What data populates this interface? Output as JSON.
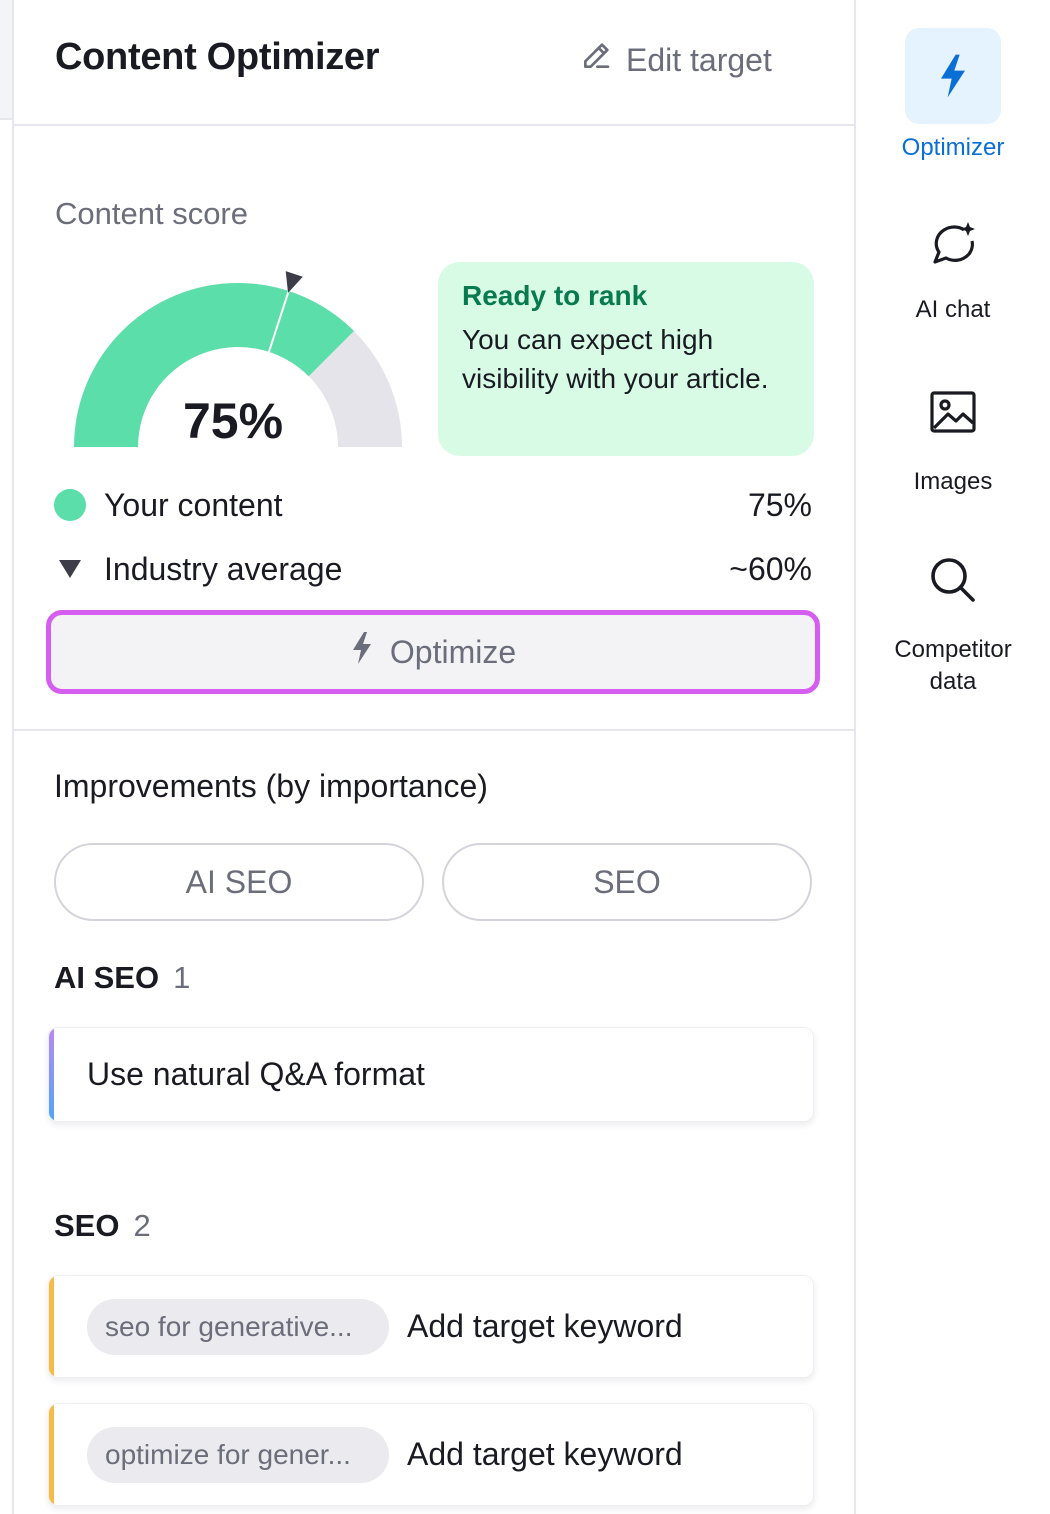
{
  "header": {
    "title": "Content Optimizer",
    "edit_target": "Edit target",
    "edit_icon": "pencil-icon"
  },
  "score": {
    "label": "Content score",
    "value_text": "75%",
    "value": 75,
    "industry_average": 60,
    "colors": {
      "your_content": "#5cdeaa",
      "remaining": "#e4e4ea",
      "marker": "#3c3d48"
    },
    "status_title": "Ready to rank",
    "status_text": "You can expect high visibility with your article.",
    "legend": [
      {
        "label": "Your content",
        "value": "75%"
      },
      {
        "label": "Industry average",
        "value": "~60%"
      }
    ]
  },
  "optimize_button": {
    "label": "Optimize",
    "icon": "bolt-icon",
    "highlight_color": "#d55ef0"
  },
  "improvements": {
    "title": "Improvements (by importance)",
    "filters": [
      "AI SEO",
      "SEO"
    ],
    "groups": [
      {
        "name": "AI SEO",
        "count": "1",
        "accent": [
          "#b98af0",
          "#4ea6f5"
        ],
        "items": [
          {
            "text": "Use natural Q&A format"
          }
        ]
      },
      {
        "name": "SEO",
        "count": "2",
        "accent": [
          "#f5bb45",
          "#f5bb45"
        ],
        "items": [
          {
            "chip": "seo for generative...",
            "text": "Add target keyword"
          },
          {
            "chip": "optimize for gener...",
            "text": "Add target keyword"
          }
        ]
      }
    ]
  },
  "rail": {
    "items": [
      {
        "label": "Optimizer",
        "icon": "bolt-icon",
        "active": true
      },
      {
        "label": "AI chat",
        "icon": "chat-sparkle-icon"
      },
      {
        "label": "Images",
        "icon": "image-icon"
      },
      {
        "label": "Competitor data",
        "icon": "search-icon"
      }
    ]
  }
}
